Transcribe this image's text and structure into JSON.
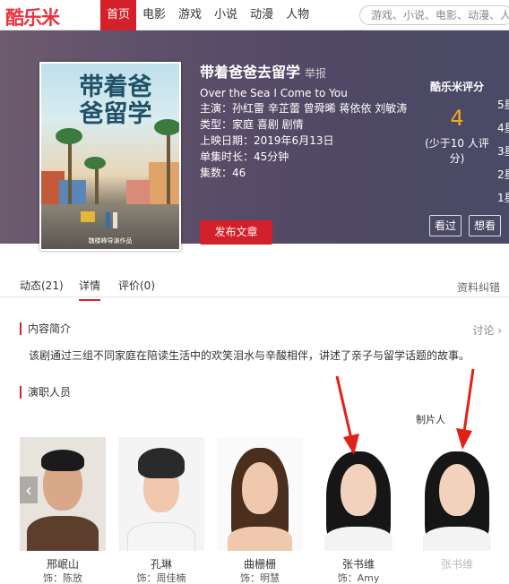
{
  "header": {
    "logo": "酷乐米",
    "nav": [
      "首页",
      "电影",
      "游戏",
      "小说",
      "动漫",
      "人物"
    ],
    "search_placeholder": "游戏、小说、电影、动漫、人"
  },
  "hero": {
    "poster_title": "带着爸爸留学",
    "poster_credit": "魏楼峰导演作品",
    "title": "带着爸爸去留学",
    "report": "举报",
    "en_title": "Over the Sea I Come to You",
    "cast_label": "主演：",
    "cast": "孙红雷 辛芷蕾 曾舜晞 蒋依依 刘敏涛",
    "genre_label": "类型：",
    "genre": "家庭 喜剧 剧情",
    "date_label": "上映日期：",
    "date": "2019年6月13日",
    "length_label": "单集时长：",
    "length": "45分钟",
    "episodes_label": "集数：",
    "episodes": "46",
    "publish_button": "发布文章"
  },
  "rating": {
    "label": "酷乐米评分",
    "score": "4",
    "note": "(少于10 人评分)",
    "stars": [
      "5星",
      "4星",
      "3星",
      "2星",
      "1星"
    ],
    "buttons": [
      "看过",
      "想看"
    ]
  },
  "tabs": {
    "items": [
      "动态(21)",
      "详情",
      "评价(0)"
    ],
    "active": "详情",
    "right": "资料纠错"
  },
  "summary": {
    "heading": "内容简介",
    "discuss": "讨论 ›",
    "text": "该剧通过三组不同家庭在陪读生活中的欢笑泪水与辛酸相伴，讲述了亲子与留学话题的故事。"
  },
  "cast_section": {
    "heading": "演职人员",
    "producer_label": "制片人",
    "members": [
      {
        "name": "邢岷山",
        "role": "饰：陈放"
      },
      {
        "name": "孔琳",
        "role": "饰：周佳楠"
      },
      {
        "name": "曲栅栅",
        "role": "饰：明慧"
      },
      {
        "name": "张书维",
        "role": "饰：Amy"
      },
      {
        "name": "张书维",
        "role": ""
      }
    ]
  },
  "colors": {
    "brand_red": "#d4202a",
    "score_orange": "#f5a623",
    "hero_bg": "#5a4d68"
  }
}
